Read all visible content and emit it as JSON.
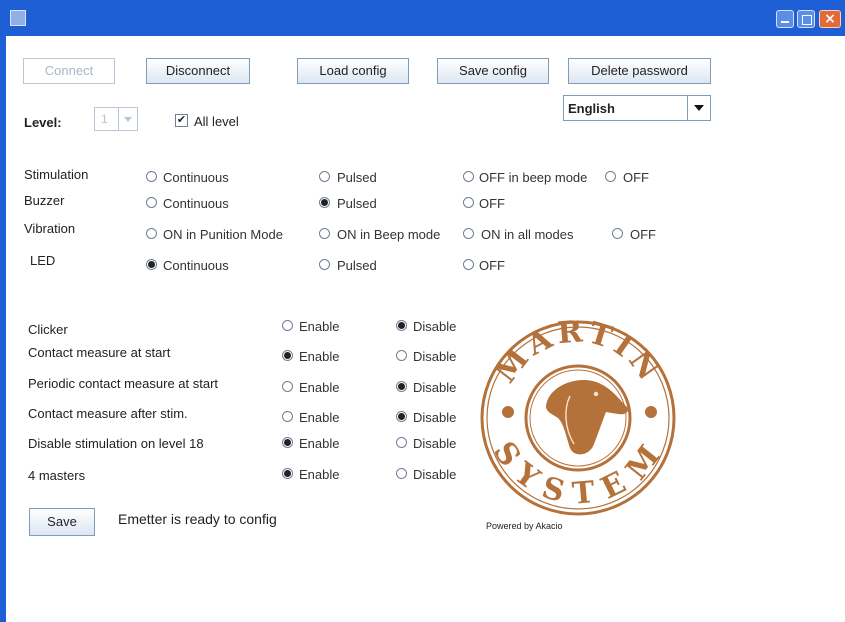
{
  "window": {
    "title": "",
    "controls": {
      "minimize": "minimize-icon",
      "maximize": "maximize-icon",
      "close": "close-icon"
    }
  },
  "toolbar": {
    "connect": "Connect",
    "disconnect": "Disconnect",
    "load_config": "Load config",
    "save_config": "Save config",
    "delete_password": "Delete password"
  },
  "language": {
    "selected": "English"
  },
  "level": {
    "label": "Level:",
    "value": "1",
    "all_level_label": "All level",
    "all_level_checked": true
  },
  "modes": [
    {
      "label": "Stimulation",
      "options": [
        "Continuous",
        "Pulsed",
        "OFF in beep mode",
        "OFF"
      ],
      "selected": null
    },
    {
      "label": "Buzzer",
      "options": [
        "Continuous",
        "Pulsed",
        "OFF"
      ],
      "selected": 1
    },
    {
      "label": "Vibration",
      "options": [
        "ON in Punition Mode",
        "ON in Beep mode",
        "ON in all modes",
        "OFF"
      ],
      "selected": null
    },
    {
      "label": "LED",
      "options": [
        "Continuous",
        "Pulsed",
        "OFF"
      ],
      "selected": 0
    }
  ],
  "settings": {
    "enable_label": "Enable",
    "disable_label": "Disable",
    "rows": [
      {
        "label": "Clicker",
        "value": "Disable"
      },
      {
        "label": "Contact measure at start",
        "value": "Enable"
      },
      {
        "label": "Periodic contact measure at start",
        "value": "Disable"
      },
      {
        "label": "Contact measure after stim.",
        "value": "Disable"
      },
      {
        "label": "Disable stimulation on level 18",
        "value": "Enable"
      },
      {
        "label": "4 masters",
        "value": "Enable"
      }
    ]
  },
  "footer": {
    "save_label": "Save",
    "status": "Emetter is ready to config"
  },
  "logo": {
    "top_text": "MARTIN",
    "bottom_text": "SYSTEM",
    "color": "#b5713a",
    "caption": "Powered by Akacio"
  },
  "colors": {
    "titlebar": "#1f5fd6",
    "button_border": "#7f9db9"
  }
}
